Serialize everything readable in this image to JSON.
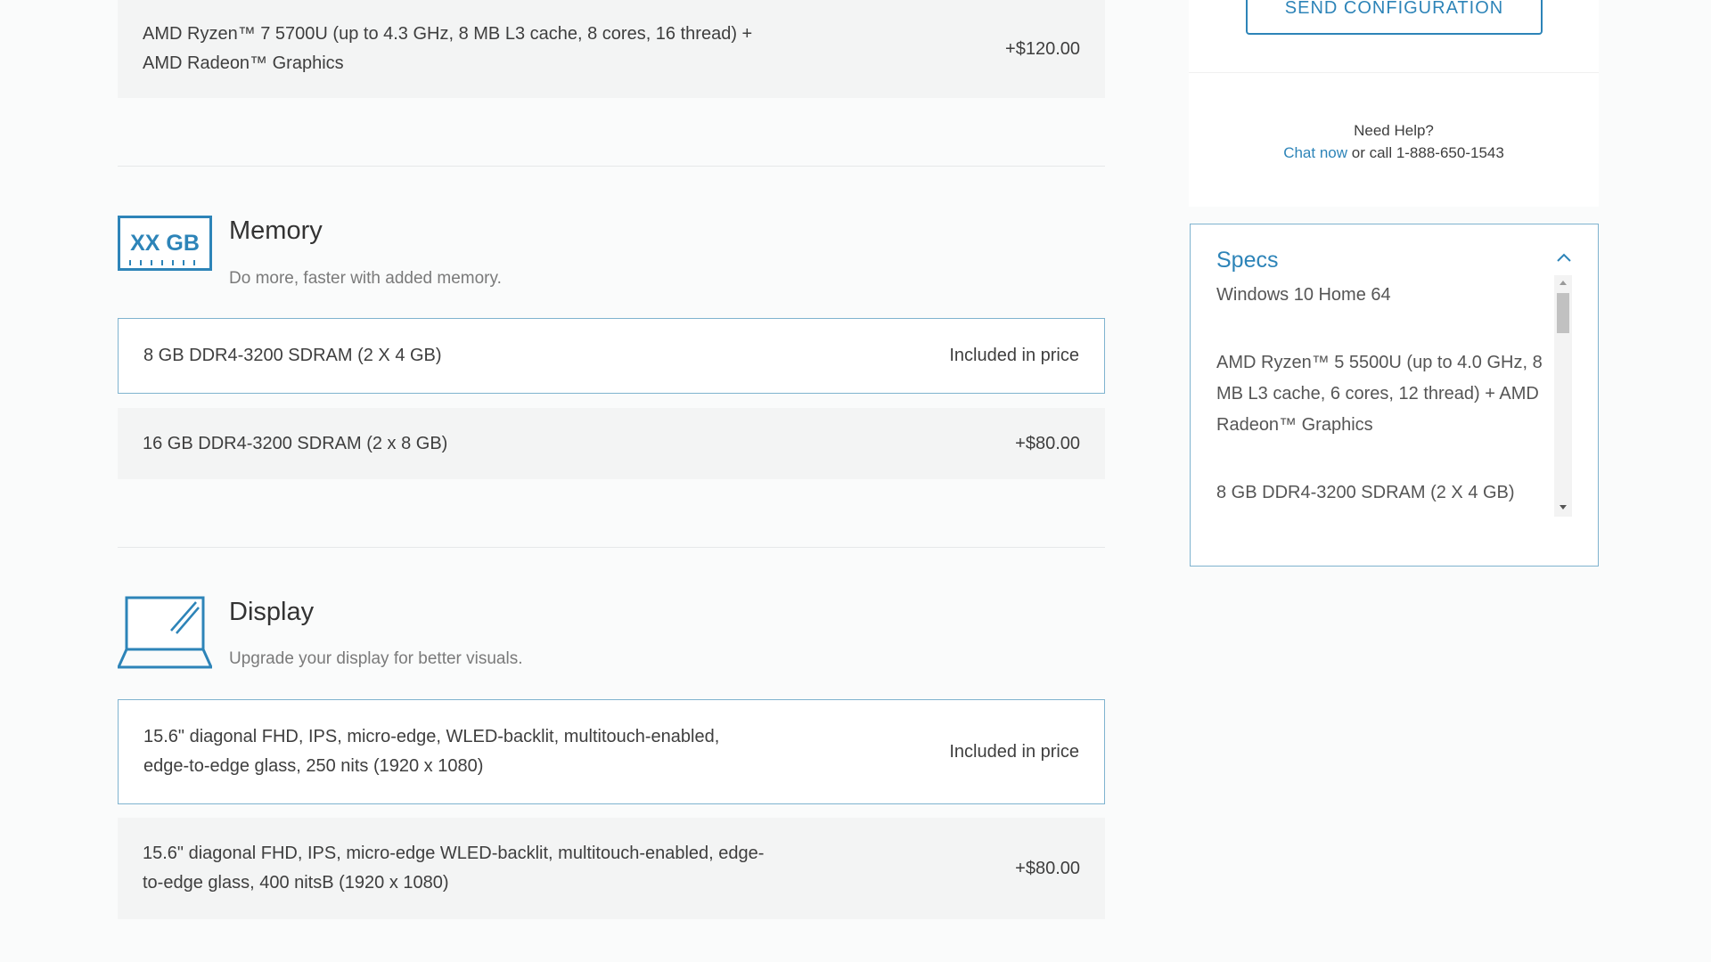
{
  "processor_option": {
    "label": "AMD Ryzen™ 7 5700U (up to 4.3 GHz, 8 MB L3 cache, 8 cores, 16 thread) + AMD Radeon™ Graphics",
    "price": "+$120.00"
  },
  "memory": {
    "icon_text": "XX GB",
    "title": "Memory",
    "description": "Do more, faster with added memory.",
    "options": [
      {
        "label": "8 GB DDR4-3200 SDRAM (2 X 4 GB)",
        "price": "Included in price",
        "selected": true
      },
      {
        "label": "16 GB DDR4-3200 SDRAM (2 x 8 GB)",
        "price": "+$80.00",
        "selected": false
      }
    ]
  },
  "display": {
    "title": "Display",
    "description": "Upgrade your display for better visuals.",
    "options": [
      {
        "label": "15.6\" diagonal FHD, IPS, micro-edge, WLED-backlit, multitouch-enabled, edge-to-edge glass, 250 nits (1920 x 1080)",
        "price": "Included in price",
        "selected": true
      },
      {
        "label": "15.6\" diagonal FHD, IPS, micro-edge WLED-backlit, multitouch-enabled, edge-to-edge glass, 400 nitsB (1920 x 1080)",
        "price": "+$80.00",
        "selected": false
      }
    ]
  },
  "help": {
    "send_button": "SEND CONFIGURATION",
    "need_help": "Need Help?",
    "chat_link": "Chat now",
    "call_text": "or call 1-888-650-1543"
  },
  "specs": {
    "title": "Specs",
    "items": [
      "Windows 10 Home 64",
      "AMD Ryzen™ 5 5500U (up to 4.0 GHz, 8 MB L3 cache, 6 cores, 12 thread) + AMD Radeon™ Graphics",
      "8 GB DDR4-3200 SDRAM (2 X 4 GB)"
    ]
  },
  "colors": {
    "accent": "#2d84b8",
    "selected_border": "#7fb3cf",
    "option_bg": "#f3f4f4",
    "page_bg": "#fafbfb"
  }
}
